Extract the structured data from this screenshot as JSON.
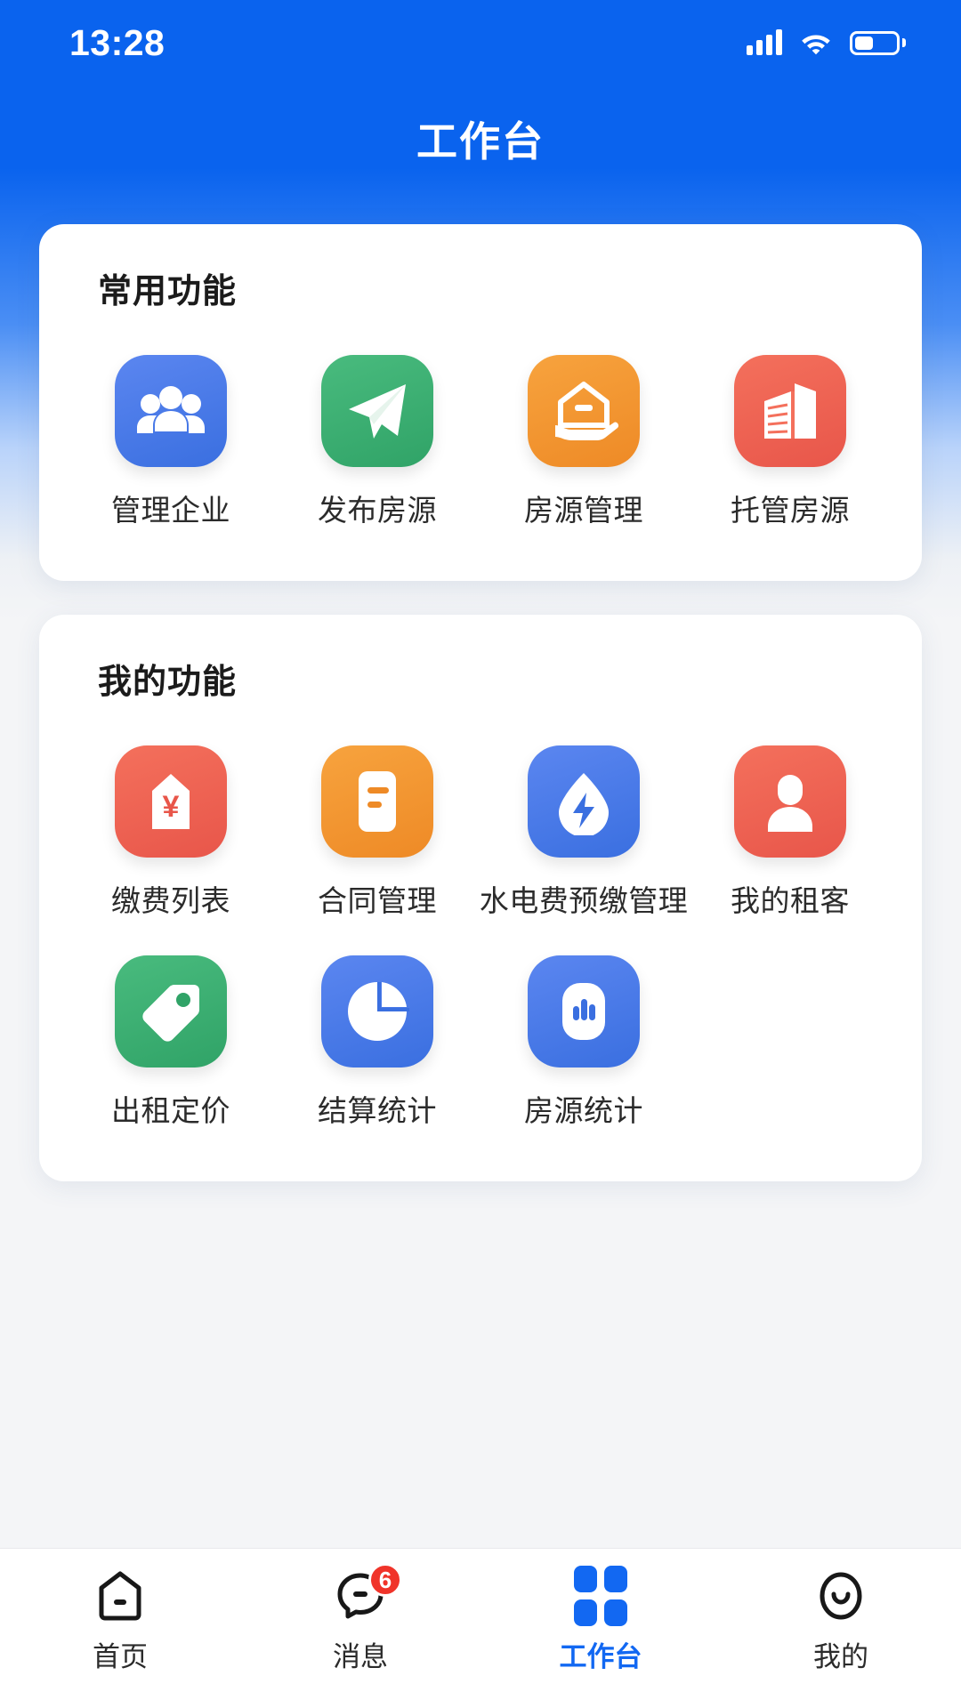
{
  "statusbar": {
    "time": "13:28",
    "signal_icon": "signal-bars-icon",
    "wifi_icon": "wifi-icon",
    "battery_icon": "battery-icon",
    "battery_level": "45%"
  },
  "header": {
    "title": "工作台"
  },
  "theme": {
    "brand_blue": "#0a63ee",
    "accent_blue": "#1268f2",
    "badge_red": "#f0342a",
    "page_bg": "#f4f5f7",
    "card_bg": "#ffffff",
    "text_primary": "#1b1b1b"
  },
  "sections": [
    {
      "title": "常用功能",
      "items": [
        {
          "label": "管理企业",
          "icon": "people-group-icon",
          "color_from": "#5b86f0",
          "color_to": "#3a6fe0"
        },
        {
          "label": "发布房源",
          "icon": "paper-plane-icon",
          "color_from": "#49bb7e",
          "color_to": "#30a367"
        },
        {
          "label": "房源管理",
          "icon": "house-in-hand-icon",
          "color_from": "#f7a33e",
          "color_to": "#ee8a26"
        },
        {
          "label": "托管房源",
          "icon": "buildings-icon",
          "color_from": "#f4705c",
          "color_to": "#e8564a"
        }
      ]
    },
    {
      "title": "我的功能",
      "items": [
        {
          "label": "缴费列表",
          "icon": "yuan-tag-icon",
          "color_from": "#f4705c",
          "color_to": "#e8564a"
        },
        {
          "label": "合同管理",
          "icon": "document-icon",
          "color_from": "#f7a33e",
          "color_to": "#ee8a26"
        },
        {
          "label": "水电费预缴管理",
          "icon": "water-drop-bolt-icon",
          "color_from": "#5b86f0",
          "color_to": "#3a6fe0"
        },
        {
          "label": "我的租客",
          "icon": "person-icon",
          "color_from": "#f4705c",
          "color_to": "#e8564a"
        },
        {
          "label": "出租定价",
          "icon": "price-tag-icon",
          "color_from": "#49bb7e",
          "color_to": "#30a367"
        },
        {
          "label": "结算统计",
          "icon": "pie-chart-icon",
          "color_from": "#5b86f0",
          "color_to": "#3a6fe0"
        },
        {
          "label": "房源统计",
          "icon": "bar-chart-icon",
          "color_from": "#5b86f0",
          "color_to": "#3a6fe0"
        }
      ]
    }
  ],
  "tabbar": {
    "items": [
      {
        "label": "首页",
        "icon": "home-icon",
        "active": false,
        "badge": ""
      },
      {
        "label": "消息",
        "icon": "message-icon",
        "active": false,
        "badge": "6"
      },
      {
        "label": "工作台",
        "icon": "workbench-grid-icon",
        "active": true,
        "badge": ""
      },
      {
        "label": "我的",
        "icon": "smiley-face-icon",
        "active": false,
        "badge": ""
      }
    ]
  }
}
